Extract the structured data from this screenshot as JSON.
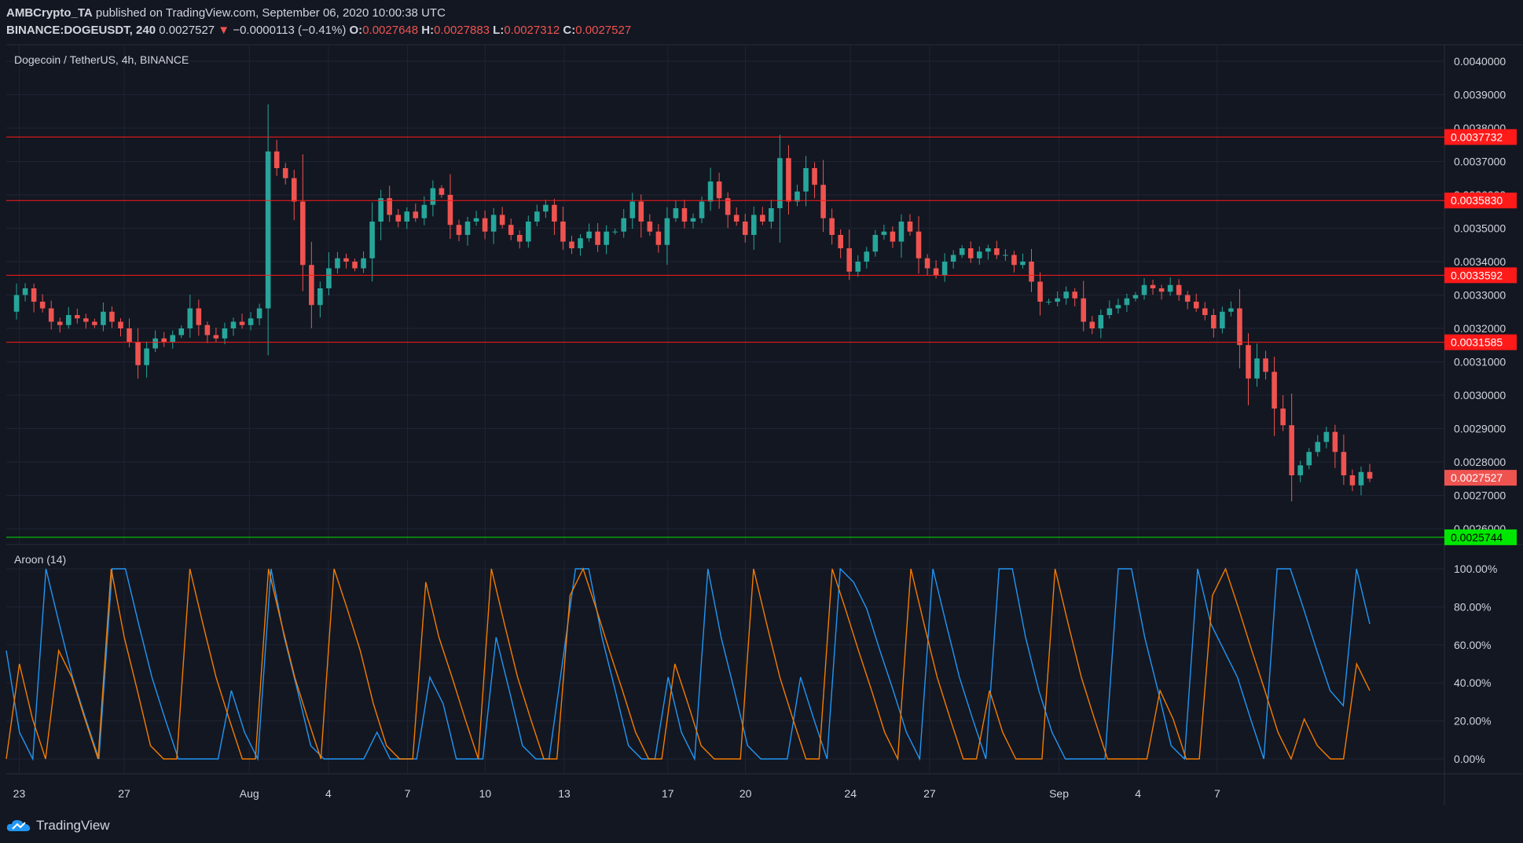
{
  "header": {
    "line1_author": "AMBCrypto_TA",
    "line1_rest": "published on TradingView.com, September 06, 2020 10:00:38 UTC",
    "symbol": "BINANCE:DOGEUSDT, 240",
    "last": "0.0027527",
    "change": "−0.0000113 (−0.41%)",
    "o_label": "O:",
    "o": "0.0027648",
    "h_label": "H:",
    "h": "0.0027883",
    "l_label": "L:",
    "l": "0.0027312",
    "c_label": "C:",
    "c": "0.0027527"
  },
  "pane_title": "Dogecoin / TetherUS, 4h, BINANCE",
  "indicator_title": "Aroon (14)",
  "footer_brand": "TradingView",
  "colors": {
    "bg": "#131722",
    "grid": "#1f2433",
    "up": "#26a69a",
    "down": "#ef5350",
    "resistance": "#ff1a1a",
    "support": "#00e600",
    "aroon_up": "#2196f3",
    "aroon_down": "#f57c00"
  },
  "chart_data": [
    {
      "type": "candlestick",
      "ylim": [
        0.0026,
        0.004
      ],
      "y_ticks": [
        "0.0040000",
        "0.0039000",
        "0.0038000",
        "0.0037000",
        "0.0036000",
        "0.0035000",
        "0.0034000",
        "0.0033000",
        "0.0032000",
        "0.0031000",
        "0.0030000",
        "0.0029000",
        "0.0028000",
        "0.0027000",
        "0.0026000"
      ],
      "x_ticks": [
        "23",
        "27",
        "Aug",
        "4",
        "7",
        "10",
        "13",
        "17",
        "20",
        "24",
        "27",
        "Sep",
        "4",
        "7"
      ],
      "horizontal_levels": [
        {
          "value": 0.0037732,
          "label": "0.0037732",
          "kind": "resistance"
        },
        {
          "value": 0.003583,
          "label": "0.0035830",
          "kind": "resistance"
        },
        {
          "value": 0.0033592,
          "label": "0.0033592",
          "kind": "resistance"
        },
        {
          "value": 0.0031585,
          "label": "0.0031585",
          "kind": "resistance"
        },
        {
          "value": 0.0025744,
          "label": "0.0025744",
          "kind": "support"
        }
      ],
      "last_price": {
        "value": 0.0027527,
        "label": "0.0027527"
      },
      "close_path": [
        [
          0.00325,
          0.0033,
          0.00332,
          0.00328,
          0.00326,
          0.00322,
          0.00321,
          0.00324,
          0.00323,
          0.00322,
          0.00321,
          0.00325,
          0.00322
        ],
        [
          0.00322,
          0.0032,
          0.00316,
          0.00309,
          0.00314,
          0.00317,
          0.00316,
          0.00318,
          0.0032,
          0.00326,
          0.00321,
          0.00318,
          0.00317,
          0.0032,
          0.00322,
          0.00321,
          0.00323,
          0.00326
        ],
        [
          0.00326,
          0.00373,
          0.00368,
          0.00365,
          0.00358,
          0.00339,
          0.00327,
          0.00332,
          0.00338,
          0.00341,
          0.0034,
          0.00338,
          0.00341,
          0.00352,
          0.00359
        ],
        [
          0.00359,
          0.00354,
          0.00352,
          0.00355,
          0.00353,
          0.00357,
          0.00362,
          0.0036,
          0.00351,
          0.00348,
          0.00352,
          0.00353,
          0.00349,
          0.00354,
          0.00351
        ],
        [
          0.00351,
          0.00348,
          0.00346,
          0.00352,
          0.00355,
          0.00357,
          0.00352,
          0.00346,
          0.00344,
          0.00347,
          0.00349,
          0.00345,
          0.00349,
          0.00349
        ],
        [
          0.00349,
          0.00353,
          0.00358,
          0.00352,
          0.00349,
          0.00345,
          0.00353,
          0.00356,
          0.00352,
          0.00353,
          0.00358,
          0.00364,
          0.00359,
          0.00354,
          0.00352,
          0.00348,
          0.00354,
          0.00352,
          0.00356
        ],
        [
          0.00356,
          0.00371,
          0.00358,
          0.00361,
          0.00368,
          0.00363,
          0.00353,
          0.00348,
          0.00344,
          0.00337,
          0.0034,
          0.00343,
          0.00348,
          0.00349,
          0.00346,
          0.00352,
          0.00349,
          0.00341,
          0.00338,
          0.00336,
          0.0034,
          0.00342,
          0.00344,
          0.00341,
          0.00343,
          0.00344,
          0.00342,
          0.00342,
          0.00339,
          0.0034
        ],
        [
          0.0034,
          0.00334,
          0.00328,
          0.00328,
          0.00329,
          0.00331,
          0.00329,
          0.00322,
          0.0032,
          0.00324,
          0.00326,
          0.00327,
          0.00329,
          0.0033,
          0.00333,
          0.00332,
          0.00331,
          0.00333,
          0.0033,
          0.00328,
          0.00326,
          0.00324,
          0.0032,
          0.00325,
          0.00326
        ],
        [
          0.00326,
          0.00315,
          0.00305,
          0.00311,
          0.00307,
          0.00296,
          0.00291,
          0.00276,
          0.00279,
          0.00283,
          0.00286,
          0.00289,
          0.00283,
          0.00276,
          0.00273,
          0.00277,
          0.00275
        ]
      ]
    },
    {
      "type": "line",
      "name": "Aroon (14)",
      "ylim": [
        0,
        100
      ],
      "y_ticks": [
        "100.00%",
        "80.00%",
        "60.00%",
        "40.00%",
        "20.00%",
        "0.00%"
      ],
      "series": [
        {
          "name": "Aroon Up",
          "color": "#2196f3",
          "values": [
            57,
            14,
            0,
            100,
            71,
            43,
            21,
            0,
            100,
            100,
            71,
            43,
            21,
            0,
            0,
            0,
            0,
            36,
            14,
            0,
            100,
            64,
            36,
            7,
            0,
            0,
            0,
            0,
            14,
            0,
            0,
            0,
            43,
            29,
            0,
            0,
            0,
            64,
            36,
            7,
            0,
            0,
            50,
            100,
            100,
            64,
            36,
            7,
            0,
            0,
            43,
            14,
            0,
            100,
            64,
            36,
            7,
            0,
            0,
            0,
            43,
            21,
            0,
            100,
            93,
            79,
            57,
            36,
            14,
            0,
            100,
            71,
            43,
            21,
            0,
            100,
            100,
            64,
            36,
            14,
            0,
            0,
            0,
            0,
            100,
            100,
            64,
            36,
            7,
            0,
            100,
            71,
            57,
            43,
            21,
            0,
            100,
            100,
            79,
            57,
            36,
            28,
            100,
            71
          ]
        },
        {
          "name": "Aroon Down",
          "color": "#f57c00",
          "values": [
            0,
            50,
            21,
            0,
            57,
            43,
            21,
            0,
            100,
            64,
            36,
            7,
            0,
            0,
            100,
            71,
            43,
            21,
            0,
            0,
            100,
            71,
            43,
            21,
            0,
            100,
            79,
            57,
            29,
            7,
            0,
            0,
            93,
            64,
            43,
            21,
            0,
            100,
            71,
            43,
            21,
            0,
            0,
            86,
            100,
            79,
            57,
            36,
            14,
            0,
            0,
            50,
            29,
            7,
            0,
            0,
            0,
            100,
            71,
            43,
            21,
            0,
            0,
            100,
            79,
            57,
            36,
            14,
            0,
            100,
            71,
            43,
            21,
            0,
            0,
            36,
            14,
            0,
            0,
            0,
            100,
            71,
            43,
            21,
            0,
            0,
            0,
            0,
            36,
            21,
            0,
            0,
            86,
            100,
            79,
            57,
            36,
            14,
            0,
            21,
            7,
            0,
            0,
            50,
            36
          ]
        }
      ]
    }
  ]
}
